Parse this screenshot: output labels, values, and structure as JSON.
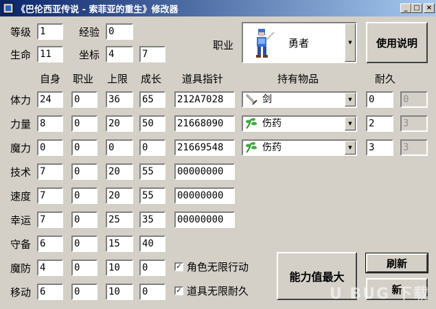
{
  "window": {
    "title": "《巴伦西亚传说 - 索菲亚的重生》修改器",
    "minimize": "_",
    "maximize": "□",
    "close": "×"
  },
  "top": {
    "level_label": "等级",
    "level": "1",
    "exp_label": "经验",
    "exp": "0",
    "hp_label": "生命",
    "hp": "11",
    "coord_label": "坐标",
    "coord_x": "4",
    "coord_y": "7",
    "job_label": "职业",
    "job_value": "勇者",
    "help_button": "使用说明"
  },
  "headers": {
    "self": "自身",
    "job": "职业",
    "limit": "上限",
    "growth": "成长",
    "pointer": "道具指针",
    "items": "持有物品",
    "durability": "耐久"
  },
  "stats": [
    {
      "label": "体力",
      "self": "24",
      "job": "0",
      "limit": "36",
      "growth": "65",
      "pointer": "212A7028"
    },
    {
      "label": "力量",
      "self": "8",
      "job": "0",
      "limit": "20",
      "growth": "50",
      "pointer": "21668090"
    },
    {
      "label": "魔力",
      "self": "0",
      "job": "0",
      "limit": "0",
      "growth": "0",
      "pointer": "21669548"
    },
    {
      "label": "技术",
      "self": "7",
      "job": "0",
      "limit": "20",
      "growth": "55",
      "pointer": "00000000"
    },
    {
      "label": "速度",
      "self": "7",
      "job": "0",
      "limit": "20",
      "growth": "55",
      "pointer": "00000000"
    },
    {
      "label": "幸运",
      "self": "7",
      "job": "0",
      "limit": "25",
      "growth": "35",
      "pointer": "00000000"
    },
    {
      "label": "守备",
      "self": "6",
      "job": "0",
      "limit": "15",
      "growth": "40"
    },
    {
      "label": "魔防",
      "self": "4",
      "job": "0",
      "limit": "10",
      "growth": "0"
    },
    {
      "label": "移动",
      "self": "6",
      "job": "0",
      "limit": "10",
      "growth": "0"
    }
  ],
  "items": [
    {
      "name": "剑",
      "icon": "sword-icon",
      "durability": "0",
      "max": "0"
    },
    {
      "name": "伤药",
      "icon": "herb-icon",
      "durability": "2",
      "max": "3"
    },
    {
      "name": "伤药",
      "icon": "herb-icon",
      "durability": "3",
      "max": "3"
    }
  ],
  "options": {
    "infinite_action": "角色无限行动",
    "infinite_durability": "道具无限耐久",
    "infinite_action_checked": true,
    "infinite_durability_checked": true
  },
  "buttons": {
    "max_stats": "能力值最大",
    "refresh": "刷新",
    "extra": "新"
  },
  "watermark": "U BUG 下载"
}
